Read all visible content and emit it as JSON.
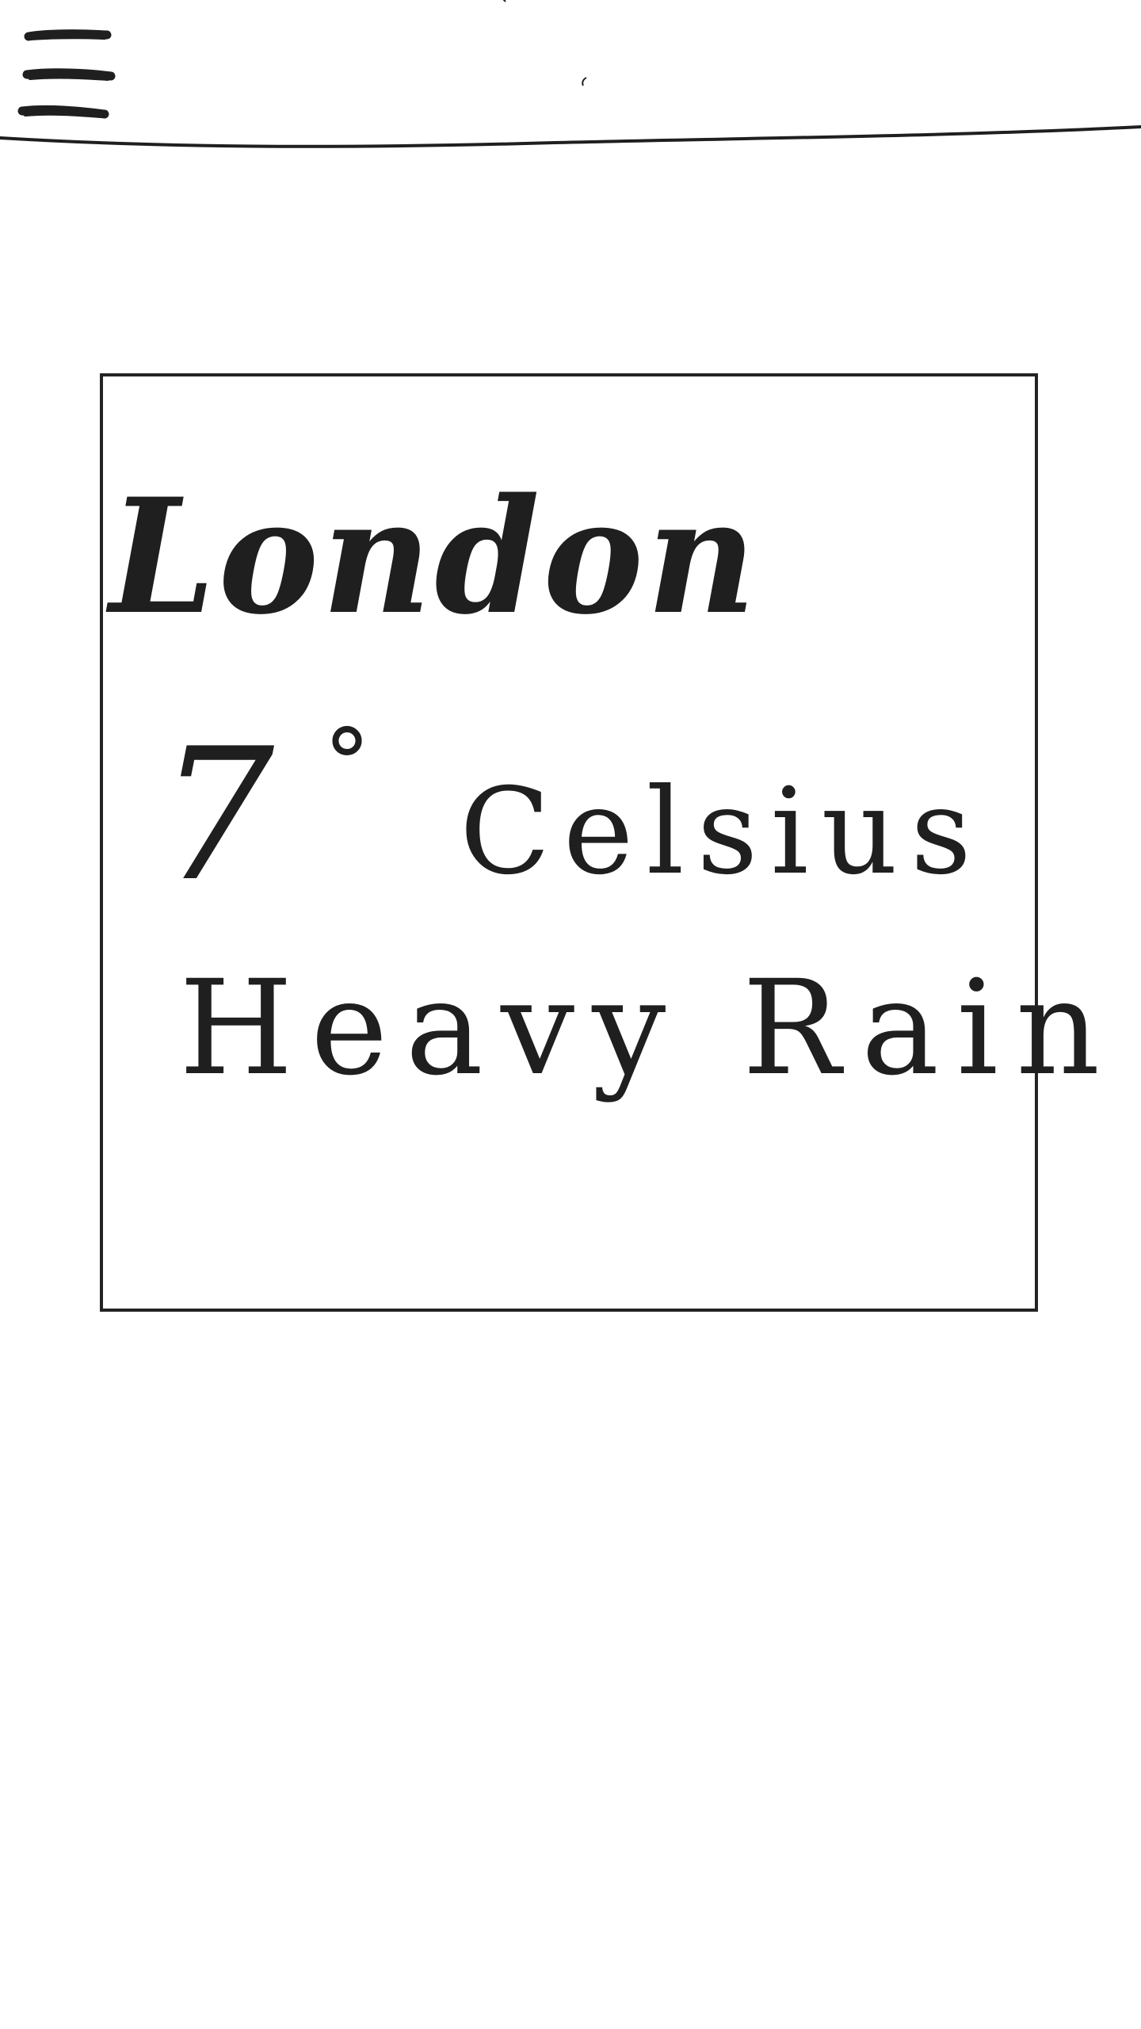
{
  "header": {
    "menu_icon": "hamburger-menu-icon"
  },
  "weather": {
    "city": "London",
    "temperature": "7",
    "degree_symbol": "°",
    "unit": "Celsius",
    "condition": "Heavy Rain"
  },
  "colors": {
    "stroke": "#1f1f1f",
    "background": "#ffffff",
    "card_border": "#232323"
  }
}
